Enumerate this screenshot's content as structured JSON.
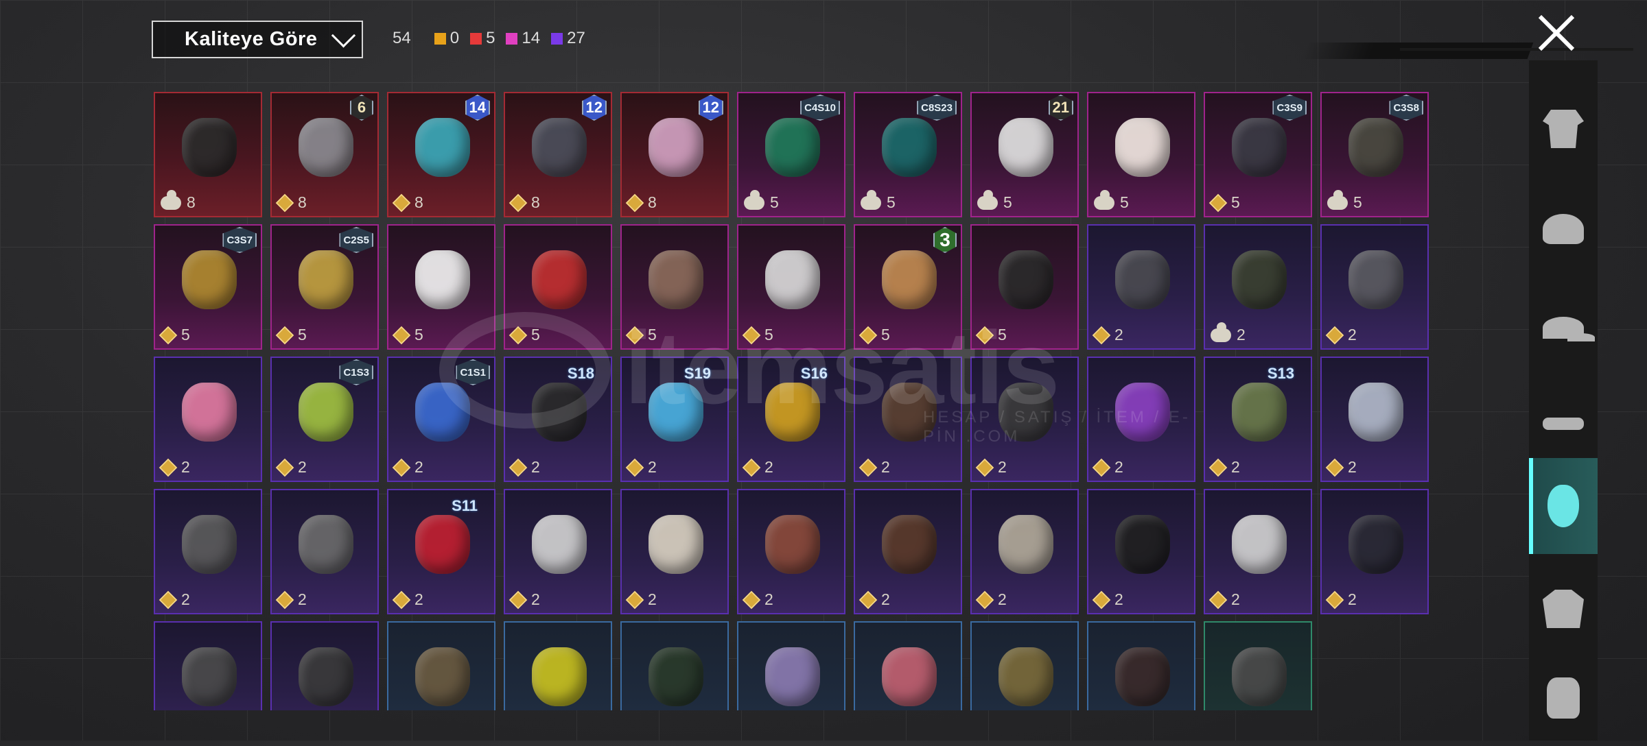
{
  "sort": {
    "label": "Kaliteye Göre"
  },
  "counts": {
    "total": "54",
    "tiers": [
      {
        "color": "#e8a21a",
        "value": "0"
      },
      {
        "color": "#e63a3a",
        "value": "5"
      },
      {
        "color": "#e040c0",
        "value": "14"
      },
      {
        "color": "#7a3ae8",
        "value": "27"
      }
    ]
  },
  "items": [
    {
      "quality": "red",
      "cost": "8",
      "currency": "cloud",
      "badge": "",
      "badge_style": "",
      "art_color": "#2b2b2b"
    },
    {
      "quality": "red",
      "cost": "8",
      "currency": "gold",
      "badge": "6",
      "badge_style": "num",
      "art_color": "#8a8a90"
    },
    {
      "quality": "red",
      "cost": "8",
      "currency": "gold",
      "badge": "14",
      "badge_style": "blue",
      "art_color": "#3aa8b8"
    },
    {
      "quality": "red",
      "cost": "8",
      "currency": "gold",
      "badge": "12",
      "badge_style": "blue",
      "art_color": "#4a4e5a"
    },
    {
      "quality": "red",
      "cost": "8",
      "currency": "gold",
      "badge": "12",
      "badge_style": "blue",
      "art_color": "#d0a0c0"
    },
    {
      "quality": "pink",
      "cost": "5",
      "currency": "cloud",
      "badge": "C4S10",
      "badge_style": "season",
      "art_color": "#1f7a5a"
    },
    {
      "quality": "pink",
      "cost": "5",
      "currency": "cloud",
      "badge": "C8S23",
      "badge_style": "season",
      "art_color": "#1a6a6a"
    },
    {
      "quality": "pink",
      "cost": "5",
      "currency": "cloud",
      "badge": "21",
      "badge_style": "num",
      "art_color": "#e0e0e0"
    },
    {
      "quality": "pink",
      "cost": "5",
      "currency": "cloud",
      "badge": "",
      "badge_style": "",
      "art_color": "#f0e6e0"
    },
    {
      "quality": "pink",
      "cost": "5",
      "currency": "gold",
      "badge": "C3S9",
      "badge_style": "season",
      "art_color": "#3a3a44"
    },
    {
      "quality": "pink",
      "cost": "5",
      "currency": "cloud",
      "badge": "C3S8",
      "badge_style": "season",
      "art_color": "#4a4a40"
    },
    {
      "quality": "pink",
      "cost": "5",
      "currency": "gold",
      "badge": "C3S7",
      "badge_style": "season",
      "art_color": "#b08a30"
    },
    {
      "quality": "pink",
      "cost": "5",
      "currency": "gold",
      "badge": "C2S5",
      "badge_style": "season",
      "art_color": "#c0a040"
    },
    {
      "quality": "pink",
      "cost": "5",
      "currency": "gold",
      "badge": "",
      "badge_style": "",
      "art_color": "#f0f0f0"
    },
    {
      "quality": "pink",
      "cost": "5",
      "currency": "gold",
      "badge": "",
      "badge_style": "",
      "art_color": "#c03030"
    },
    {
      "quality": "pink",
      "cost": "5",
      "currency": "gold",
      "badge": "",
      "badge_style": "",
      "art_color": "#8a6a5a"
    },
    {
      "quality": "pink",
      "cost": "5",
      "currency": "gold",
      "badge": "",
      "badge_style": "",
      "art_color": "#d8d8d8"
    },
    {
      "quality": "pink",
      "cost": "5",
      "currency": "gold",
      "badge": "3",
      "badge_style": "green",
      "art_color": "#c08a50"
    },
    {
      "quality": "pink",
      "cost": "5",
      "currency": "gold",
      "badge": "",
      "badge_style": "",
      "art_color": "#2a2a2a"
    },
    {
      "quality": "purple",
      "cost": "2",
      "currency": "gold",
      "badge": "",
      "badge_style": "",
      "art_color": "#4a4a50"
    },
    {
      "quality": "purple",
      "cost": "2",
      "currency": "cloud",
      "badge": "",
      "badge_style": "",
      "art_color": "#3a4030"
    },
    {
      "quality": "purple",
      "cost": "2",
      "currency": "gold",
      "badge": "",
      "badge_style": "",
      "art_color": "#5a5a60"
    },
    {
      "quality": "purple",
      "cost": "2",
      "currency": "gold",
      "badge": "",
      "badge_style": "",
      "art_color": "#e07aa0"
    },
    {
      "quality": "purple",
      "cost": "2",
      "currency": "gold",
      "badge": "C1S3",
      "badge_style": "season",
      "art_color": "#a0c040"
    },
    {
      "quality": "purple",
      "cost": "2",
      "currency": "gold",
      "badge": "C1S1",
      "badge_style": "season",
      "art_color": "#3a6ad0"
    },
    {
      "quality": "purple",
      "cost": "2",
      "currency": "gold",
      "badge": "S18",
      "badge_style": "wing",
      "art_color": "#2a2a2a"
    },
    {
      "quality": "purple",
      "cost": "2",
      "currency": "gold",
      "badge": "S19",
      "badge_style": "wing",
      "art_color": "#4ab0e0"
    },
    {
      "quality": "purple",
      "cost": "2",
      "currency": "gold",
      "badge": "S16",
      "badge_style": "wing",
      "art_color": "#d0a020"
    },
    {
      "quality": "purple",
      "cost": "2",
      "currency": "gold",
      "badge": "",
      "badge_style": "",
      "art_color": "#5a4030"
    },
    {
      "quality": "purple",
      "cost": "2",
      "currency": "gold",
      "badge": "",
      "badge_style": "",
      "art_color": "#3a3a3a"
    },
    {
      "quality": "purple",
      "cost": "2",
      "currency": "gold",
      "badge": "",
      "badge_style": "",
      "art_color": "#8a40c0"
    },
    {
      "quality": "purple",
      "cost": "2",
      "currency": "gold",
      "badge": "S13",
      "badge_style": "wing",
      "art_color": "#6a7a4a"
    },
    {
      "quality": "purple",
      "cost": "2",
      "currency": "gold",
      "badge": "",
      "badge_style": "",
      "art_color": "#b0b8c8"
    },
    {
      "quality": "purple",
      "cost": "2",
      "currency": "gold",
      "badge": "",
      "badge_style": "",
      "art_color": "#5a5a5a"
    },
    {
      "quality": "purple",
      "cost": "2",
      "currency": "gold",
      "badge": "",
      "badge_style": "",
      "art_color": "#6a6a6a"
    },
    {
      "quality": "purple",
      "cost": "2",
      "currency": "gold",
      "badge": "S11",
      "badge_style": "wing",
      "art_color": "#c02030"
    },
    {
      "quality": "purple",
      "cost": "2",
      "currency": "gold",
      "badge": "",
      "badge_style": "",
      "art_color": "#d0d0d0"
    },
    {
      "quality": "purple",
      "cost": "2",
      "currency": "gold",
      "badge": "",
      "badge_style": "",
      "art_color": "#d8d0c0"
    },
    {
      "quality": "purple",
      "cost": "2",
      "currency": "gold",
      "badge": "",
      "badge_style": "",
      "art_color": "#8a4a3a"
    },
    {
      "quality": "purple",
      "cost": "2",
      "currency": "gold",
      "badge": "",
      "badge_style": "",
      "art_color": "#5a3a2a"
    },
    {
      "quality": "purple",
      "cost": "2",
      "currency": "gold",
      "badge": "",
      "badge_style": "",
      "art_color": "#b0a898"
    },
    {
      "quality": "purple",
      "cost": "2",
      "currency": "gold",
      "badge": "",
      "badge_style": "",
      "art_color": "#202020"
    },
    {
      "quality": "purple",
      "cost": "2",
      "currency": "gold",
      "badge": "",
      "badge_style": "",
      "art_color": "#d0d0d0"
    },
    {
      "quality": "purple",
      "cost": "2",
      "currency": "gold",
      "badge": "",
      "badge_style": "",
      "art_color": "#2a2a34"
    },
    {
      "quality": "purple",
      "cost": "",
      "currency": "",
      "badge": "",
      "badge_style": "",
      "art_color": "#4a4a4a"
    },
    {
      "quality": "purple",
      "cost": "",
      "currency": "",
      "badge": "",
      "badge_style": "",
      "art_color": "#3a3a3a"
    },
    {
      "quality": "blue",
      "cost": "",
      "currency": "",
      "badge": "",
      "badge_style": "",
      "art_color": "#6a5a40"
    },
    {
      "quality": "blue",
      "cost": "",
      "currency": "",
      "badge": "",
      "badge_style": "",
      "art_color": "#c8c020"
    },
    {
      "quality": "blue",
      "cost": "",
      "currency": "",
      "badge": "",
      "badge_style": "",
      "art_color": "#2a3a2a"
    },
    {
      "quality": "blue",
      "cost": "",
      "currency": "",
      "badge": "",
      "badge_style": "",
      "art_color": "#8a7ab0"
    },
    {
      "quality": "blue",
      "cost": "",
      "currency": "",
      "badge": "",
      "badge_style": "",
      "art_color": "#c06070"
    },
    {
      "quality": "blue",
      "cost": "",
      "currency": "",
      "badge": "",
      "badge_style": "",
      "art_color": "#7a6a3a"
    },
    {
      "quality": "blue",
      "cost": "",
      "currency": "",
      "badge": "",
      "badge_style": "",
      "art_color": "#3a2a2a"
    },
    {
      "quality": "green",
      "cost": "",
      "currency": "",
      "badge": "",
      "badge_style": "",
      "art_color": "#4a4a4a"
    }
  ],
  "side_tabs": [
    {
      "name": "tab-outfit",
      "icon": "outfit-icon",
      "active": false
    },
    {
      "name": "tab-helmet",
      "icon": "helmet-icon",
      "active": false
    },
    {
      "name": "tab-hat",
      "icon": "cap-icon",
      "active": false
    },
    {
      "name": "tab-glasses",
      "icon": "glasses-icon",
      "active": false
    },
    {
      "name": "tab-mask",
      "icon": "mask-icon",
      "active": true
    },
    {
      "name": "tab-jacket",
      "icon": "jacket-icon",
      "active": false
    },
    {
      "name": "tab-backpack",
      "icon": "backpack-icon",
      "active": false
    }
  ],
  "watermark": {
    "brand": "itemsatis",
    "subtitle": "HESAP / SATIŞ / İTEM / E-PİN .COM"
  },
  "colors": {
    "active_tab": "#285c5a",
    "accent": "#6ff"
  }
}
